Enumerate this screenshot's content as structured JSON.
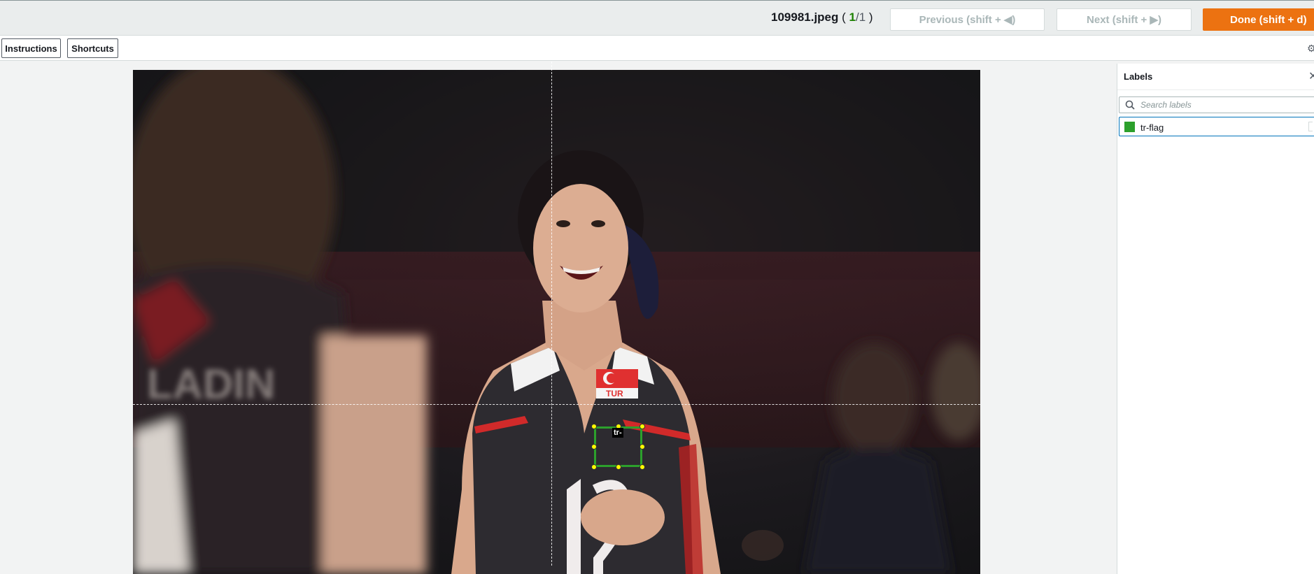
{
  "header": {
    "filename": "109981.jpeg",
    "counter_open": " ( ",
    "counter_current": "1",
    "counter_sep": "/",
    "counter_total": "1",
    "counter_close": " )",
    "previous_label": "Previous (shift + ◀)",
    "next_label": "Next (shift + ▶)",
    "done_label": "Done (shift + d)"
  },
  "toolbar": {
    "instructions_label": "Instructions",
    "shortcuts_label": "Shortcuts"
  },
  "canvas": {
    "annotation_tag": "tr-"
  },
  "labels_panel": {
    "title": "Labels",
    "search_placeholder": "Search labels",
    "items": [
      {
        "name": "tr-flag",
        "color": "#2ca02c"
      }
    ]
  },
  "colors": {
    "accent": "#ec7211",
    "label_color": "#2ca02c",
    "handle_color": "#ffff00"
  },
  "icons": [
    "settings-icon",
    "close-icon",
    "search-icon"
  ]
}
